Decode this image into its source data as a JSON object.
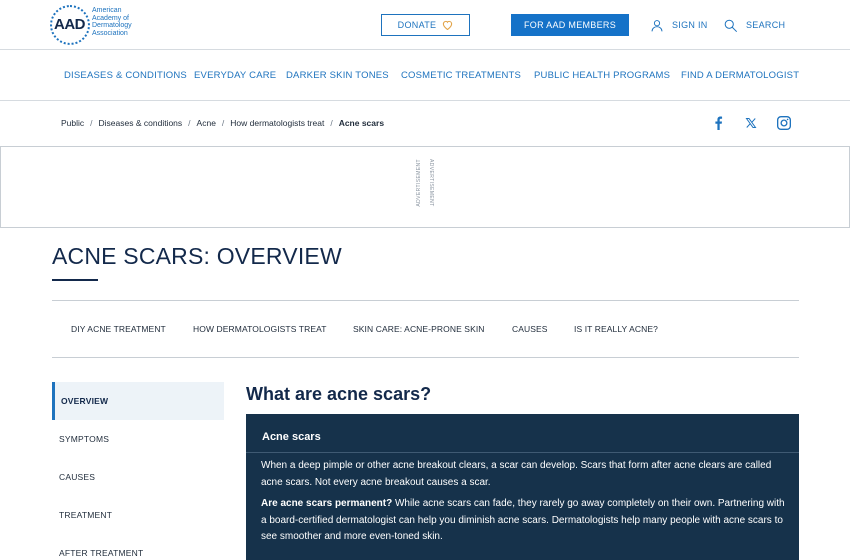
{
  "header": {
    "logo": {
      "mark": "AAD",
      "lines": [
        "American",
        "Academy of",
        "Dermatology",
        "Association"
      ]
    },
    "donate_label": "DONATE",
    "members_label": "FOR AAD MEMBERS",
    "signin_label": "SIGN IN",
    "search_label": "SEARCH"
  },
  "main_nav": [
    "DISEASES & CONDITIONS",
    "EVERYDAY CARE",
    "DARKER SKIN TONES",
    "COSMETIC TREATMENTS",
    "PUBLIC HEALTH PROGRAMS",
    "FIND A DERMATOLOGIST"
  ],
  "breadcrumb": {
    "items": [
      "Public",
      "Diseases & conditions",
      "Acne",
      "How dermatologists treat"
    ],
    "current": "Acne scars"
  },
  "social": [
    "facebook-icon",
    "x-icon",
    "instagram-icon"
  ],
  "ad": {
    "label": "ADVERTISEMENT"
  },
  "page": {
    "title": "ACNE SCARS: OVERVIEW"
  },
  "sub_nav": [
    "DIY ACNE TREATMENT",
    "HOW DERMATOLOGISTS TREAT",
    "SKIN CARE: ACNE-PRONE SKIN",
    "CAUSES",
    "IS IT REALLY ACNE?"
  ],
  "sidebar": {
    "items": [
      "OVERVIEW",
      "SYMPTOMS",
      "CAUSES",
      "TREATMENT",
      "AFTER TREATMENT"
    ],
    "active": "OVERVIEW"
  },
  "content": {
    "heading": "What are acne scars?",
    "box_title": "Acne scars",
    "p1": "When a deep pimple or other acne breakout clears, a scar can develop. Scars that form after acne clears are called acne scars. Not every acne breakout causes a scar.",
    "p2_lead": "Are acne scars permanent?",
    "p2": " While acne scars can fade, they rarely go away completely on their own. Partnering with a board-certified dermatologist can help you diminish acne scars. Dermatologists help many people with acne scars to see smoother and more even-toned skin."
  },
  "colors": {
    "accent": "#1e73be",
    "primary_button": "#1572c8",
    "navy": "#13294b",
    "infobox": "#16324b",
    "donate_heart": "#e2a44a"
  }
}
